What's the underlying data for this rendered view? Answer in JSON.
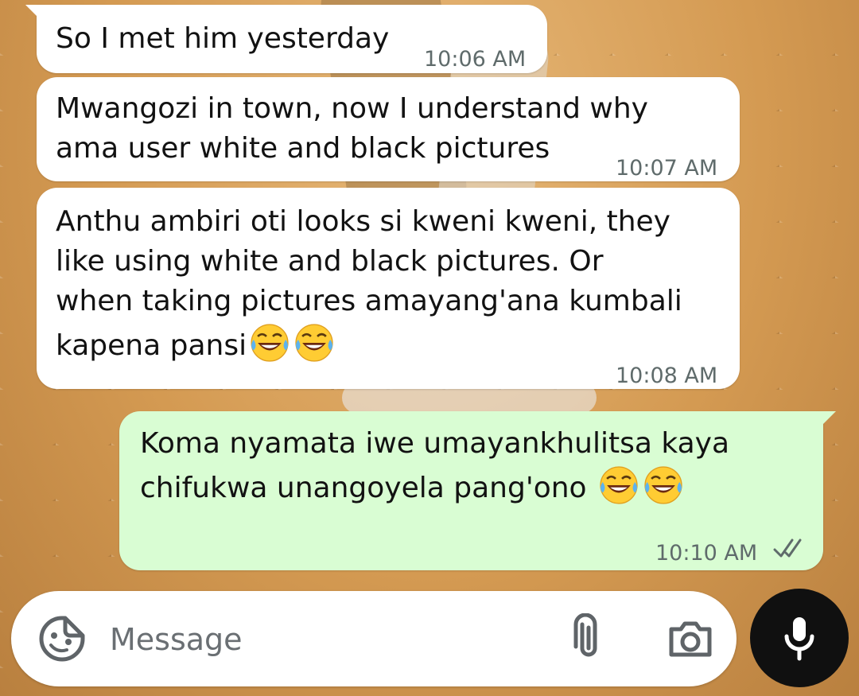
{
  "theme": {
    "incoming_bubble": "#ffffff",
    "outgoing_bubble": "#d9fdd3",
    "timestamp_color": "#5f6b6b",
    "read_ticks_color": "#5f6b6b",
    "mic_button": "#101010"
  },
  "messages": [
    {
      "direction": "incoming",
      "text": "So I met him yesterday",
      "time": "10:06 AM"
    },
    {
      "direction": "incoming",
      "text": "Mwangozi in town, now I understand why\nama user white and black pictures",
      "time": "10:07 AM"
    },
    {
      "direction": "incoming",
      "text": "Anthu ambiri oti looks si kweni kweni, they\nlike using white and black pictures. Or\nwhen taking pictures amayang'ana kumbali\nkapena pansi",
      "emoji": [
        "face-with-tears-of-joy",
        "face-with-tears-of-joy"
      ],
      "time": "10:08 AM"
    },
    {
      "direction": "outgoing",
      "text": "Koma nyamata iwe umayankhulitsa kaya\nchifukwa unangoyela pang'ono ",
      "emoji": [
        "face-with-tears-of-joy",
        "face-with-tears-of-joy"
      ],
      "time": "10:10 AM",
      "status": "read"
    }
  ],
  "composer": {
    "placeholder": "Message",
    "value": "",
    "icons": {
      "left": "sticker-icon",
      "attach": "paperclip-icon",
      "camera": "camera-icon",
      "send": "microphone-icon"
    }
  }
}
